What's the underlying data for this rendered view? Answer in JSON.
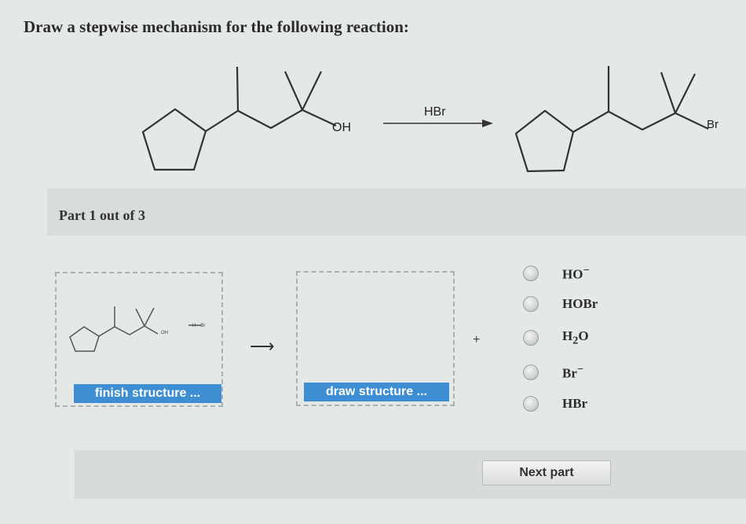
{
  "question": "Draw a stepwise mechanism for the following reaction:",
  "reaction": {
    "reactant_label": "OH",
    "reagent": "HBr",
    "product_label": "Br"
  },
  "part": {
    "label": "Part 1 out of 3"
  },
  "step_area": {
    "mini_oh": "OH",
    "mini_hbr": "H—Br",
    "finish_button": "finish structure ...",
    "draw_button": "draw structure ...",
    "plus": "+",
    "arrow": "⟶"
  },
  "options": [
    {
      "base": "HO",
      "sup": "−"
    },
    {
      "base": "HOBr",
      "sup": ""
    },
    {
      "base": "H",
      "sub": "2",
      "rest": "O"
    },
    {
      "base": "Br",
      "sup": "−"
    },
    {
      "base": "HBr",
      "sup": ""
    }
  ],
  "next_button": "Next part"
}
